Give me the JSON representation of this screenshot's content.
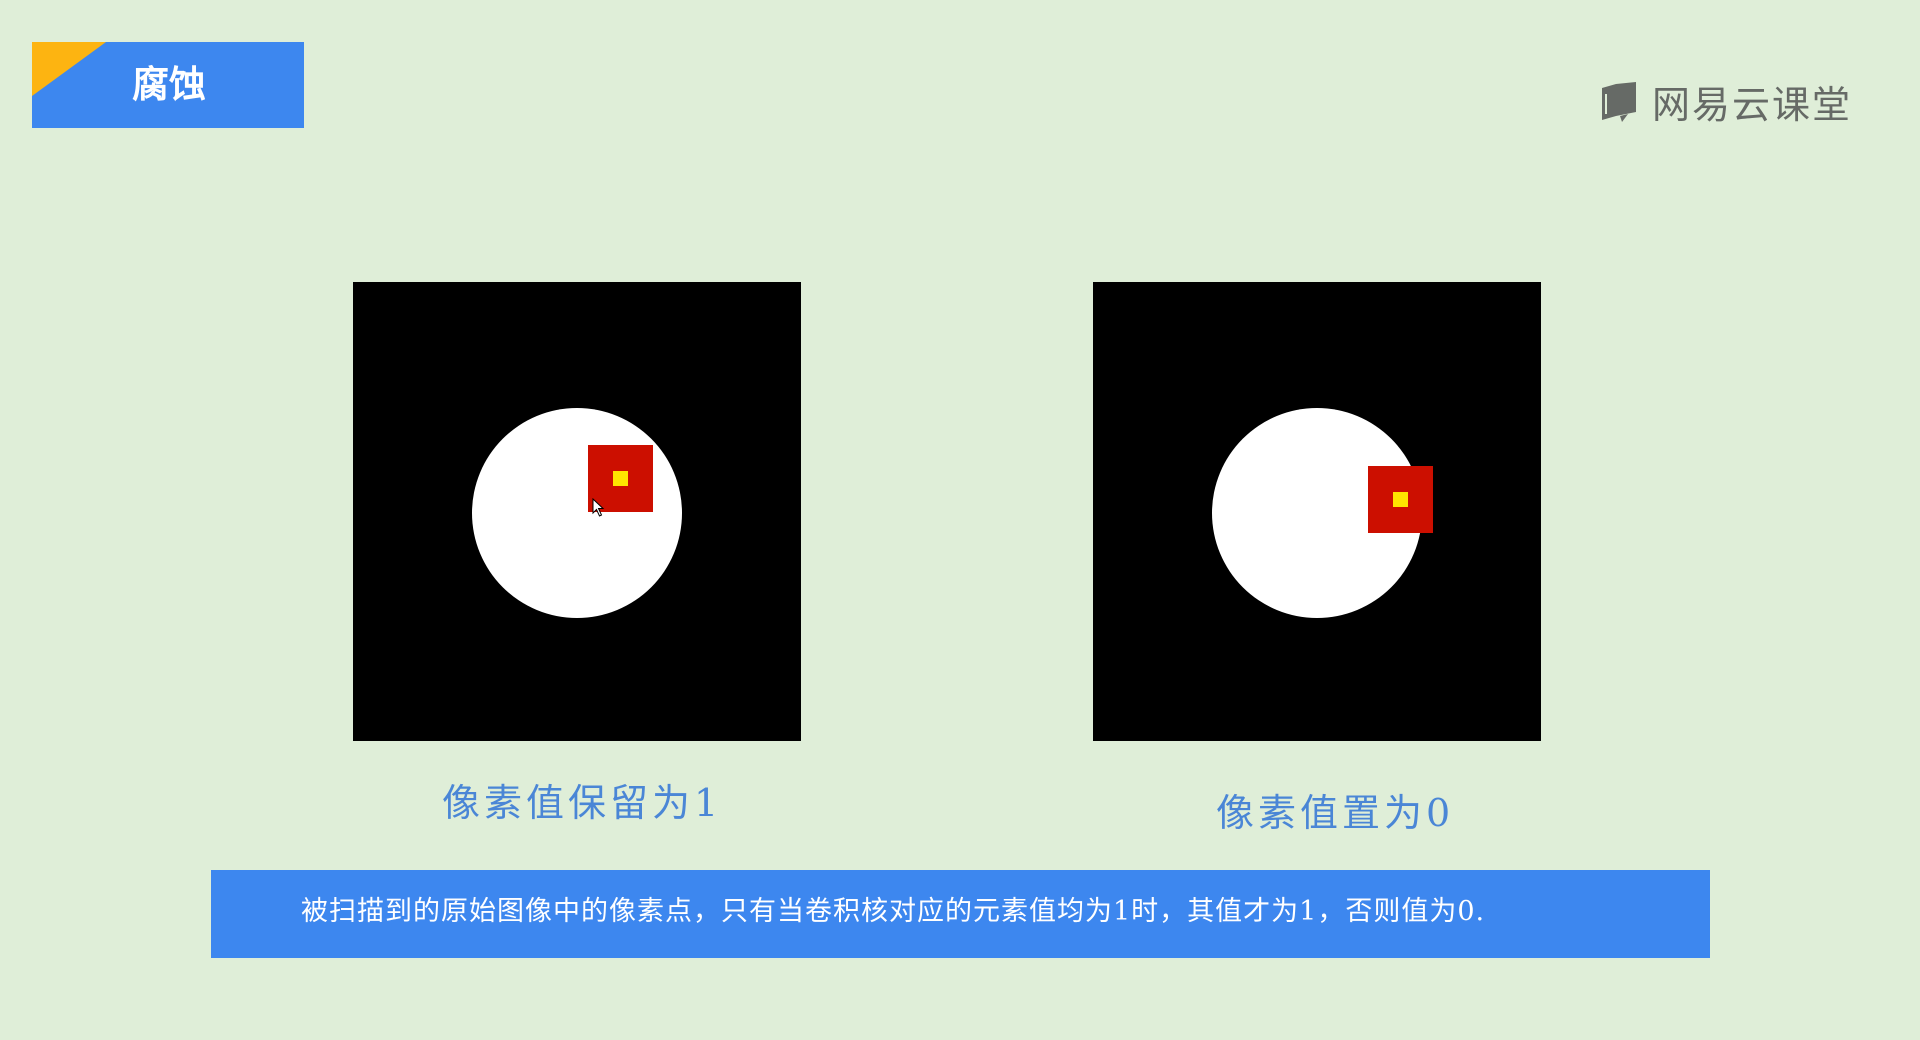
{
  "header": {
    "title": "腐蚀"
  },
  "logo": {
    "text": "网易云课堂",
    "icon": "book-logo-icon"
  },
  "panels": [
    {
      "caption": "像素值保留为1",
      "kernel_color": "#cc0f00",
      "center_color": "#ffe500"
    },
    {
      "caption": "像素值置为0",
      "kernel_color": "#cc0f00",
      "center_color": "#ffe500"
    }
  ],
  "description": "被扫描到的原始图像中的像素点，只有当卷积核对应的元素值均为1时，其值才为1，否则值为0.",
  "colors": {
    "background": "#dfeed8",
    "accent_blue": "#3d87ef",
    "accent_yellow": "#fdb411",
    "caption_blue": "#4a86d6"
  }
}
